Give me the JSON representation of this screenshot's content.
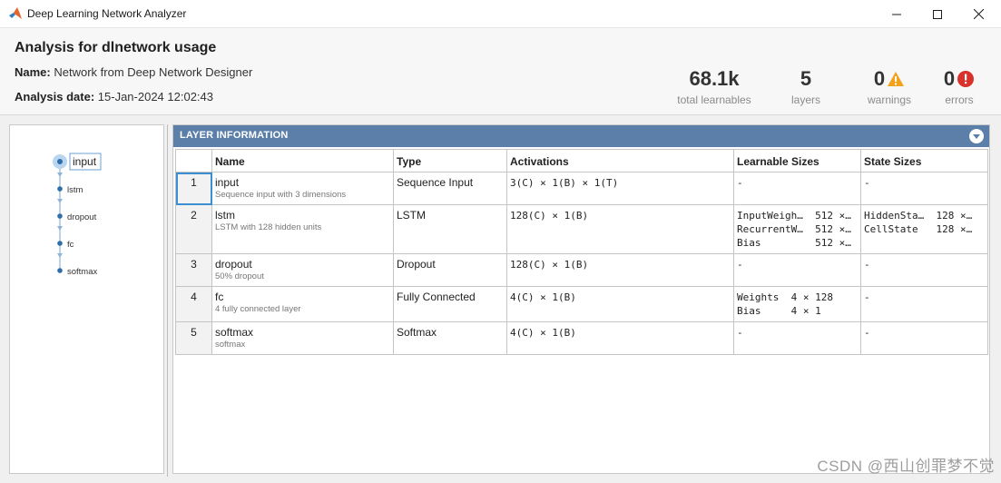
{
  "window": {
    "title": "Deep Learning Network Analyzer"
  },
  "header": {
    "title": "Analysis for dlnetwork usage",
    "name_label": "Name:",
    "name_value": "Network from Deep Network Designer",
    "date_label": "Analysis date:",
    "date_value": "15-Jan-2024 12:02:43",
    "stats": {
      "learnables": {
        "value": "68.1k",
        "label": "total learnables"
      },
      "layers": {
        "value": "5",
        "label": "layers"
      },
      "warnings": {
        "value": "0",
        "label": "warnings",
        "icon": "warning-triangle-icon",
        "color": "#f2a21c"
      },
      "errors": {
        "value": "0",
        "label": "errors",
        "icon": "error-circle-icon",
        "color": "#d9312b"
      }
    }
  },
  "graph": {
    "nodes": [
      "input",
      "lstm",
      "dropout",
      "fc",
      "softmax"
    ],
    "selected": "input",
    "node_color": "#2f6ea8"
  },
  "layer_info": {
    "title": "LAYER INFORMATION",
    "columns": [
      "Name",
      "Type",
      "Activations",
      "Learnable Sizes",
      "State Sizes"
    ],
    "rows": [
      {
        "index": "1",
        "name": "input",
        "desc": "Sequence input with 3 dimensions",
        "type": "Sequence Input",
        "activations": "3(C) × 1(B) × 1(T)",
        "learnables": "-",
        "states": "-"
      },
      {
        "index": "2",
        "name": "lstm",
        "desc": "LSTM with 128 hidden units",
        "type": "LSTM",
        "activations": "128(C) × 1(B)",
        "learnables": "InputWeigh…  512 ×…\nRecurrentW…  512 ×…\nBias         512 ×…",
        "states": "HiddenSta…  128 ×…\nCellState   128 ×…"
      },
      {
        "index": "3",
        "name": "dropout",
        "desc": "50% dropout",
        "type": "Dropout",
        "activations": "128(C) × 1(B)",
        "learnables": "-",
        "states": "-"
      },
      {
        "index": "4",
        "name": "fc",
        "desc": "4 fully connected layer",
        "type": "Fully Connected",
        "activations": "4(C) × 1(B)",
        "learnables": "Weights  4 × 128\nBias     4 × 1",
        "states": "-"
      },
      {
        "index": "5",
        "name": "softmax",
        "desc": "softmax",
        "type": "Softmax",
        "activations": "4(C) × 1(B)",
        "learnables": "-",
        "states": "-"
      }
    ]
  },
  "watermark": "CSDN @西山创罪梦不觉",
  "colors": {
    "panel_header": "#5b7fa8",
    "selection": "#3d8dd1"
  }
}
